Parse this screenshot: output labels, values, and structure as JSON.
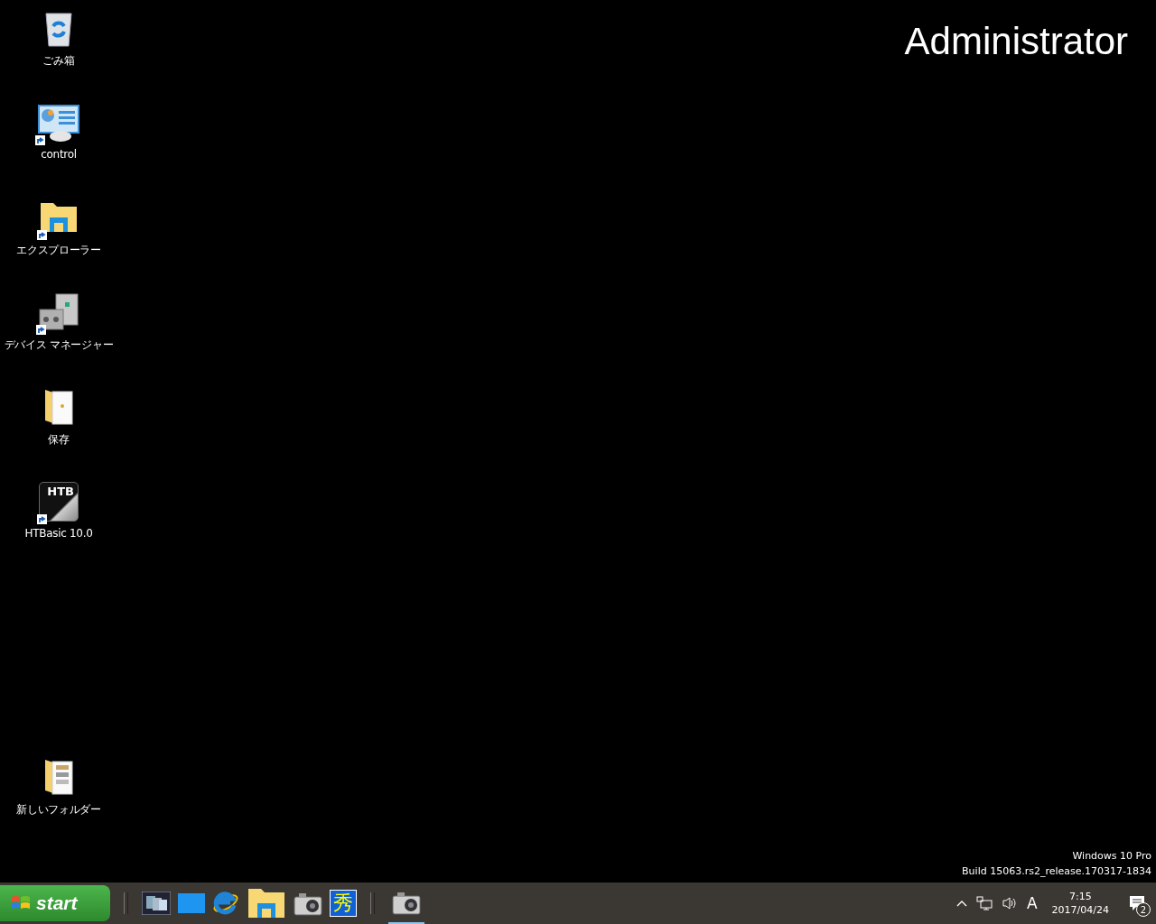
{
  "desktop": {
    "user_label": "Administrator",
    "icons": [
      {
        "kind": "recycle-bin",
        "label": "ごみ箱",
        "shortcut": false
      },
      {
        "kind": "control-panel",
        "label": "control",
        "shortcut": true
      },
      {
        "kind": "explorer",
        "label": "エクスプローラー",
        "shortcut": true
      },
      {
        "kind": "device-manager",
        "label": "デバイス マネージャー",
        "shortcut": true
      },
      {
        "kind": "folder",
        "label": "保存",
        "shortcut": false
      },
      {
        "kind": "htb",
        "label": "HTBasic 10.0",
        "badge": "HTB",
        "shortcut": true
      }
    ],
    "bottom_icons": [
      {
        "kind": "folder-docs",
        "label": "新しいフォルダー",
        "shortcut": false
      }
    ],
    "watermark": [
      "Windows 10 Pro",
      "Build 15063.rs2_release.170317-1834"
    ]
  },
  "taskbar": {
    "start_label": "start",
    "quick_launch": [
      {
        "kind": "windows-switch"
      },
      {
        "kind": "desktop"
      },
      {
        "kind": "ie"
      },
      {
        "kind": "explorer"
      },
      {
        "kind": "camera"
      },
      {
        "kind": "glyph",
        "glyph": "秀"
      }
    ],
    "tasks": [
      {
        "kind": "camera",
        "selected": true
      }
    ],
    "tray": {
      "ime": "A",
      "time": "7:15",
      "date": "2017/04/24",
      "notifications": "2"
    }
  }
}
